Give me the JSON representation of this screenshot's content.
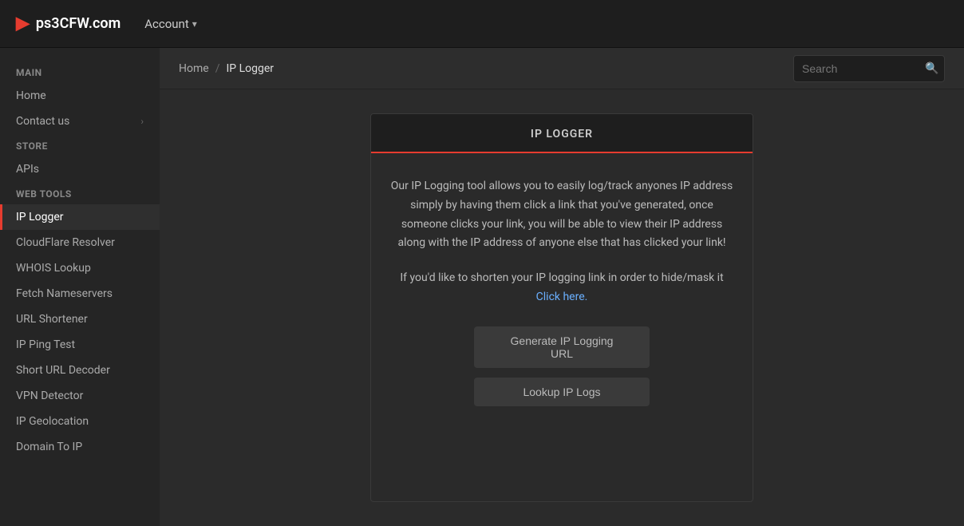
{
  "navbar": {
    "brand_text": "ps3CFW.com",
    "brand_icon": "▶",
    "account_label": "Account",
    "account_chevron": "▾"
  },
  "breadcrumb": {
    "home_label": "Home",
    "separator": "/",
    "current_label": "IP Logger"
  },
  "search": {
    "placeholder": "Search",
    "icon": "🔍"
  },
  "sidebar": {
    "sections": [
      {
        "label": "Main",
        "items": [
          {
            "id": "home",
            "label": "Home",
            "active": false,
            "chevron": false
          },
          {
            "id": "contact-us",
            "label": "Contact us",
            "active": false,
            "chevron": true
          }
        ]
      },
      {
        "label": "Store",
        "items": [
          {
            "id": "apis",
            "label": "APIs",
            "active": false,
            "chevron": false
          }
        ]
      },
      {
        "label": "Web Tools",
        "items": [
          {
            "id": "ip-logger",
            "label": "IP Logger",
            "active": true,
            "chevron": false
          },
          {
            "id": "cloudflare-resolver",
            "label": "CloudFlare Resolver",
            "active": false,
            "chevron": false
          },
          {
            "id": "whois-lookup",
            "label": "WHOIS Lookup",
            "active": false,
            "chevron": false
          },
          {
            "id": "fetch-nameservers",
            "label": "Fetch Nameservers",
            "active": false,
            "chevron": false
          },
          {
            "id": "url-shortener",
            "label": "URL Shortener",
            "active": false,
            "chevron": false
          },
          {
            "id": "ip-ping-test",
            "label": "IP Ping Test",
            "active": false,
            "chevron": false
          },
          {
            "id": "short-url-decoder",
            "label": "Short URL Decoder",
            "active": false,
            "chevron": false
          },
          {
            "id": "vpn-detector",
            "label": "VPN Detector",
            "active": false,
            "chevron": false
          },
          {
            "id": "ip-geolocation",
            "label": "IP Geolocation",
            "active": false,
            "chevron": false
          },
          {
            "id": "domain-to-ip",
            "label": "Domain To IP",
            "active": false,
            "chevron": false
          }
        ]
      }
    ]
  },
  "tool": {
    "title": "IP LOGGER",
    "description_1": "Our IP Logging tool allows you to easily log/track anyones IP address simply by having them click a link that you've generated, once someone clicks your link, you will be able to view their IP address along with the IP address of anyone else that has clicked your link!",
    "description_2_prefix": "If you'd like to shorten your IP logging link in order to hide/mask it ",
    "description_2_link": "Click here.",
    "btn_generate": "Generate IP Logging URL",
    "btn_lookup": "Lookup IP Logs"
  }
}
